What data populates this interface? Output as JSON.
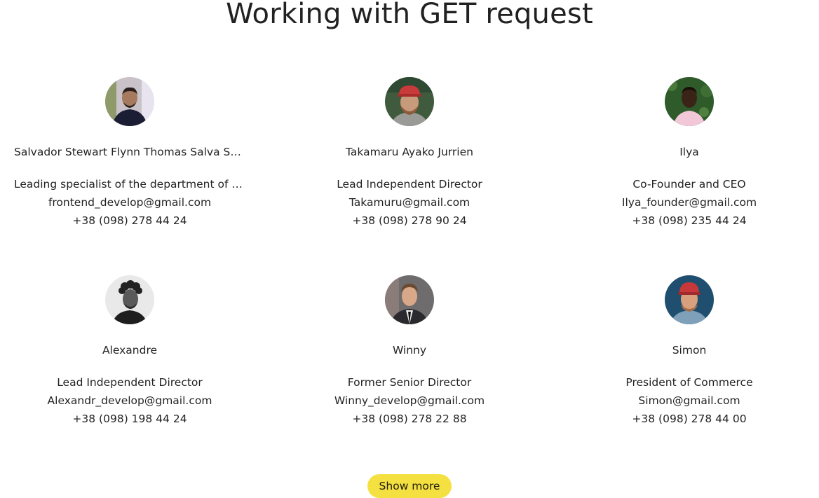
{
  "page": {
    "title": "Working with GET request"
  },
  "users": [
    {
      "name": "Salvador Stewart Flynn Thomas Salva Salve...",
      "position": "Leading specialist of the department of cent...",
      "email": "frontend_develop@gmail.com",
      "phone": "+38 (098) 278 44 24",
      "avatar_icon": "user-photo-man-indoor"
    },
    {
      "name": "Takamaru Ayako Jurrien",
      "position": "Lead Independent Director",
      "email": "Takamuru@gmail.com",
      "phone": "+38 (098) 278 90 24",
      "avatar_icon": "user-photo-man-red-cap"
    },
    {
      "name": "Ilya",
      "position": "Co-Founder and CEO",
      "email": "Ilya_founder@gmail.com",
      "phone": "+38 (098) 235 44 24",
      "avatar_icon": "user-photo-man-green-background"
    },
    {
      "name": "Alexandre",
      "position": "Lead Independent Director",
      "email": "Alexandr_develop@gmail.com",
      "phone": "+38 (098) 198 44 24",
      "avatar_icon": "user-photo-man-black-white"
    },
    {
      "name": "Winny",
      "position": "Former Senior Director",
      "email": "Winny_develop@gmail.com",
      "phone": "+38 (098) 278 22 88",
      "avatar_icon": "user-photo-man-suit"
    },
    {
      "name": "Simon",
      "position": "President of Commerce",
      "email": "Simon@gmail.com",
      "phone": "+38 (098) 278 44 00",
      "avatar_icon": "user-photo-man-red-cap-blue-background"
    }
  ],
  "actions": {
    "show_more_label": "Show more"
  },
  "colors": {
    "button_bg": "#f4e041",
    "text": "rgba(0,0,0,0.87)",
    "background": "#ffffff"
  }
}
